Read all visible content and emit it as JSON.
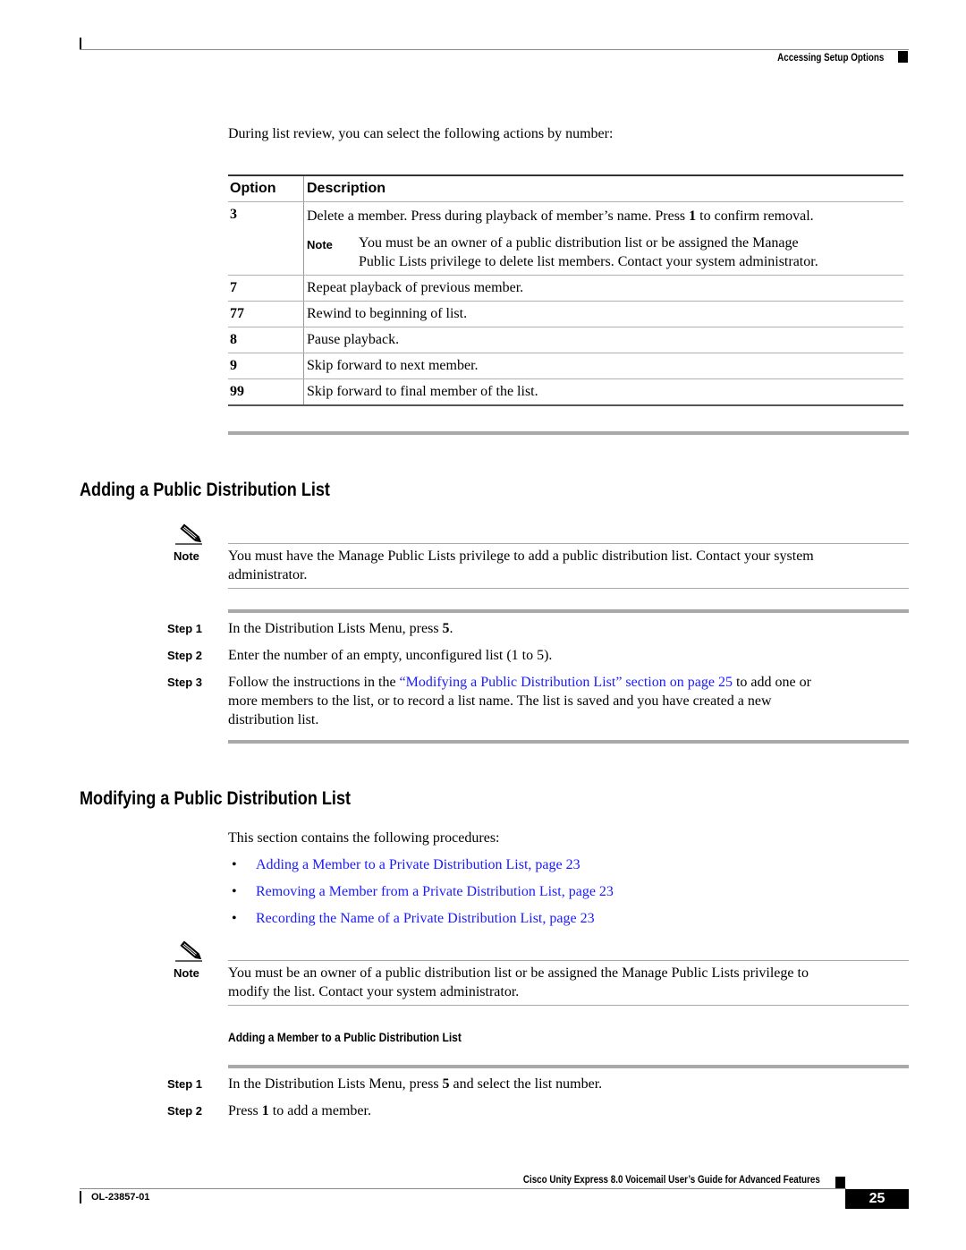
{
  "header": {
    "section_title": "Accessing Setup Options"
  },
  "intro": "During list review, you can select the following actions by number:",
  "table": {
    "headers": {
      "option": "Option",
      "description": "Description"
    },
    "rows": [
      {
        "option": "3",
        "description_pre": "Delete a member. Press during playback of member’s name. Press ",
        "description_bold": "1",
        "description_post": " to confirm removal.",
        "note_label": "Note",
        "note_line1": "You must be an owner of a public distribution list or be assigned the Manage",
        "note_line2": "Public Lists privilege to delete list members. Contact your system administrator."
      },
      {
        "option": "7",
        "description": "Repeat playback of previous member."
      },
      {
        "option": "77",
        "description": "Rewind to beginning of list."
      },
      {
        "option": "8",
        "description": "Pause playback."
      },
      {
        "option": "9",
        "description": "Skip forward to next member."
      },
      {
        "option": "99",
        "description": "Skip forward to final member of the list."
      }
    ]
  },
  "section_adding": {
    "title": "Adding a Public Distribution List",
    "note": {
      "label": "Note",
      "line1": "You must have the Manage Public Lists privilege to add a public distribution list. Contact your system",
      "line2": "administrator."
    },
    "steps": [
      {
        "label": "Step 1",
        "pre": "In the Distribution Lists Menu, press ",
        "bold": "5",
        "post": "."
      },
      {
        "label": "Step 2",
        "text": "Enter the number of an empty, unconfigured list (1 to 5)."
      },
      {
        "label": "Step 3",
        "pre": "Follow the instructions in the ",
        "link": "“Modifying a Public Distribution List” section on page 25",
        "post": " to add one or",
        "line2": "more members to the list, or to record a list name. The list is saved and you have created a new",
        "line3": "distribution list."
      }
    ]
  },
  "section_modifying": {
    "title": "Modifying a Public Distribution List",
    "intro": "This section contains the following procedures:",
    "bullet_glyph": "•",
    "links": [
      "Adding a Member to a Private Distribution List, page 23",
      "Removing a Member from a Private Distribution List, page 23",
      "Recording the Name of a Private Distribution List, page 23"
    ],
    "note": {
      "label": "Note",
      "line1": "You must be an owner of a public distribution list or be assigned the Manage Public Lists privilege to",
      "line2": "modify the list. Contact your system administrator."
    },
    "subsection_title": "Adding a Member to a Public Distribution List",
    "steps": [
      {
        "label": "Step 1",
        "pre": "In the Distribution Lists Menu, press ",
        "bold": "5",
        "post": " and select the list number."
      },
      {
        "label": "Step 2",
        "pre": "Press ",
        "bold": "1",
        "post": " to add a member."
      }
    ]
  },
  "footer": {
    "book_title": "Cisco Unity Express 8.0 Voicemail User’s Guide for Advanced Features",
    "doc_number": "OL-23857-01",
    "page_number": "25"
  },
  "icons": {
    "note": "pencil-note-icon"
  }
}
